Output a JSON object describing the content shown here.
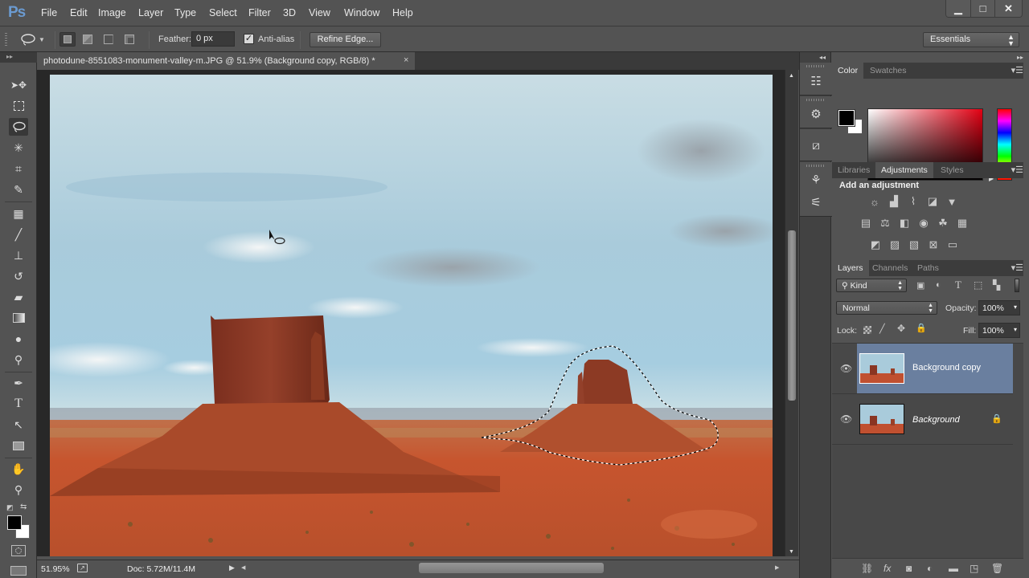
{
  "app": {
    "logo": "Ps"
  },
  "menu": [
    "File",
    "Edit",
    "Image",
    "Layer",
    "Type",
    "Select",
    "Filter",
    "3D",
    "View",
    "Window",
    "Help"
  ],
  "window_controls": {
    "minimize": "▁",
    "maximize": "□",
    "close": "✕"
  },
  "options": {
    "tool_icon": "lasso-icon",
    "feather_label": "Feather:",
    "feather_value": "0 px",
    "antialias_checked": true,
    "antialias_label": "Anti-alias",
    "refine_edge_label": "Refine Edge...",
    "workspace": "Essentials"
  },
  "document": {
    "tab_title": "photodune-8551083-monument-valley-m.JPG @ 51.9% (Background copy, RGB/8) *",
    "close": "×",
    "zoom": "51.95%",
    "doc_size": "Doc: 5.72M/11.4M"
  },
  "tools": [
    {
      "name": "move-tool",
      "glyph": "➤"
    },
    {
      "name": "marquee-tool",
      "glyph": "⬚"
    },
    {
      "name": "lasso-tool",
      "glyph": "◯",
      "active": true
    },
    {
      "name": "magic-wand-tool",
      "glyph": "✳"
    },
    {
      "name": "crop-tool",
      "glyph": "⌗"
    },
    {
      "name": "eyedropper-tool",
      "glyph": "✎"
    },
    {
      "name": "spot-healing-tool",
      "glyph": "▦"
    },
    {
      "name": "brush-tool",
      "glyph": "╱"
    },
    {
      "name": "clone-stamp-tool",
      "glyph": "⊥"
    },
    {
      "name": "history-brush-tool",
      "glyph": "↺"
    },
    {
      "name": "eraser-tool",
      "glyph": "▰"
    },
    {
      "name": "gradient-tool",
      "glyph": "▣"
    },
    {
      "name": "blur-tool",
      "glyph": "💧"
    },
    {
      "name": "dodge-tool",
      "glyph": "⚲"
    },
    {
      "name": "pen-tool",
      "glyph": "✒"
    },
    {
      "name": "type-tool",
      "glyph": "T"
    },
    {
      "name": "path-selection-tool",
      "glyph": "↖"
    },
    {
      "name": "rectangle-tool",
      "glyph": "▭"
    },
    {
      "name": "hand-tool",
      "glyph": "✋"
    },
    {
      "name": "zoom-tool",
      "glyph": "🔍"
    }
  ],
  "colors": {
    "foreground": "#000000",
    "background": "#ffffff",
    "accent_selected_layer": "#6a7f9f"
  },
  "color_panel": {
    "tabs": [
      "Color",
      "Swatches"
    ],
    "active": "Color"
  },
  "adjustments_panel": {
    "tabs": [
      "Libraries",
      "Adjustments",
      "Styles"
    ],
    "active": "Adjustments",
    "heading": "Add an adjustment",
    "rows": [
      [
        "brightness-contrast",
        "levels",
        "curves",
        "exposure",
        "vibrance"
      ],
      [
        "hue-saturation",
        "color-balance",
        "black-white",
        "photo-filter",
        "channel-mixer",
        "color-lookup"
      ],
      [
        "invert",
        "posterize",
        "threshold",
        "selective-color",
        "gradient-map"
      ]
    ]
  },
  "layers_panel": {
    "tabs": [
      "Layers",
      "Channels",
      "Paths"
    ],
    "active": "Layers",
    "filter_kind": "Kind",
    "blend_mode": "Normal",
    "opacity_label": "Opacity:",
    "opacity": "100%",
    "lock_label": "Lock:",
    "fill_label": "Fill:",
    "fill": "100%",
    "layers": [
      {
        "name": "Background copy",
        "visible": true,
        "selected": true,
        "locked": false
      },
      {
        "name": "Background",
        "visible": true,
        "selected": false,
        "locked": true
      }
    ]
  }
}
